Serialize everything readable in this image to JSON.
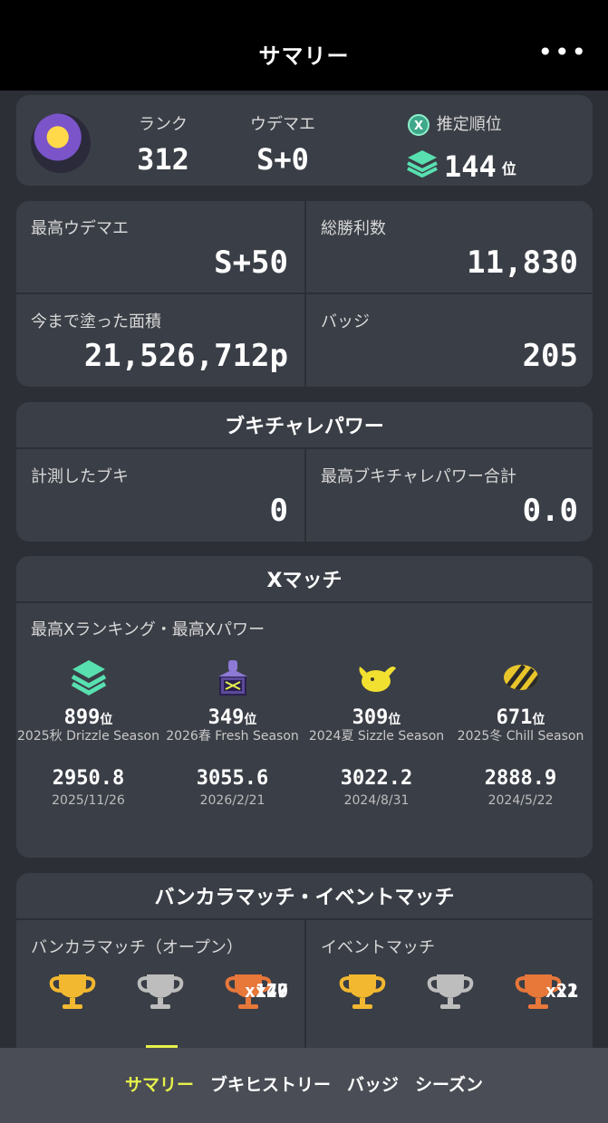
{
  "header": {
    "title": "サマリー",
    "more": "•••"
  },
  "profile": {
    "rank_label": "ランク",
    "rank_value": "312",
    "udemae_label": "ウデマエ",
    "udemae_value": "S+0",
    "estimated_label": "推定順位",
    "estimated_value": "144",
    "estimated_suffix": "位"
  },
  "stats": {
    "max_udemae_label": "最高ウデマエ",
    "max_udemae_value": "S+50",
    "total_wins_label": "総勝利数",
    "total_wins_value": "11,830",
    "paint_label": "今まで塗った面積",
    "paint_value": "21,526,712p",
    "badge_label": "バッジ",
    "badge_value": "205"
  },
  "buki": {
    "title": "ブキチャレパワー",
    "measured_label": "計測したブキ",
    "measured_value": "0",
    "max_power_label": "最高ブキチャレパワー合計",
    "max_power_value": "0.0"
  },
  "xmatch": {
    "title": "Xマッチ",
    "subtitle": "最高Xランキング・最高Xパワー",
    "suffix": "位",
    "entries": [
      {
        "icon": "x-rank-layer-icon",
        "rank": "899",
        "season": "2025秋 Drizzle Season",
        "power": "2950.8",
        "date": "2025/11/26"
      },
      {
        "icon": "tower-icon",
        "rank": "349",
        "season": "2026春 Fresh Season",
        "power": "3055.6",
        "date": "2026/2/21"
      },
      {
        "icon": "clam-icon",
        "rank": "309",
        "season": "2024夏 Sizzle Season",
        "power": "3022.2",
        "date": "2024/8/31"
      },
      {
        "icon": "rainmaker-icon",
        "rank": "671",
        "season": "2025冬 Chill Season",
        "power": "2888.9",
        "date": "2024/5/22"
      }
    ]
  },
  "bankara": {
    "title": "バンカラマッチ・イベントマッチ",
    "open_label": "バンカラマッチ（オープン）",
    "event_label": "イベントマッチ",
    "open_trophies": [
      "x147",
      "x70",
      "x29"
    ],
    "event_trophies": [
      "x22",
      "x1",
      "x1"
    ]
  },
  "tabs": [
    "サマリー",
    "ブキヒストリー",
    "バッジ",
    "シーズン"
  ],
  "colors": {
    "accent": "#e6f24a",
    "gold": "#f2b830",
    "silver": "#bdbdbd",
    "bronze": "#e8773a",
    "teal": "#58e0b0"
  }
}
